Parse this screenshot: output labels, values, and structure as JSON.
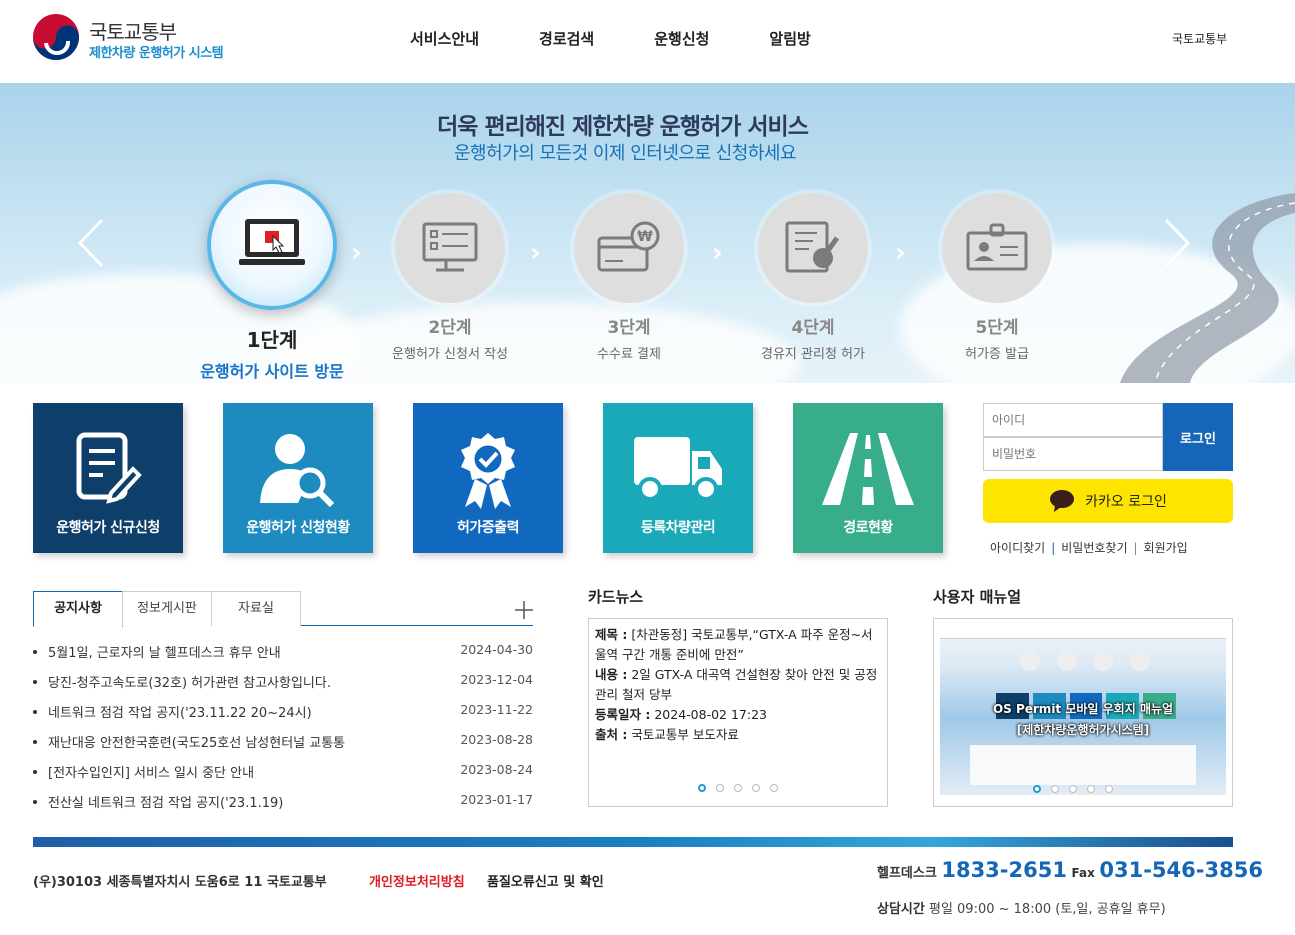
{
  "header": {
    "logo_title": "국토교통부",
    "logo_subtitle": "제한차량 운행허가 시스템",
    "nav": [
      "서비스안내",
      "경로검색",
      "운행신청",
      "알림방"
    ],
    "top_link": "국토교통부"
  },
  "hero": {
    "title": "더욱 편리해진 제한차량 운행허가 서비스",
    "subtitle": "운행허가의 모든것 이제 인터넷으로 신청하세요",
    "steps": [
      {
        "num": "1단계",
        "desc": "운행허가 사이트 방문",
        "icon": "laptop-icon",
        "active": true
      },
      {
        "num": "2단계",
        "desc": "운행허가 신청서 작성",
        "icon": "monitor-form-icon"
      },
      {
        "num": "3단계",
        "desc": "수수료 결제",
        "icon": "card-won-icon"
      },
      {
        "num": "4단계",
        "desc": "경유지 관리청 허가",
        "icon": "approval-stamp-icon"
      },
      {
        "num": "5단계",
        "desc": "허가증 발급",
        "icon": "id-card-icon"
      }
    ]
  },
  "tiles": [
    {
      "label": "운행허가 신규신청",
      "color": "#0e3f6b",
      "icon": "document-edit-icon"
    },
    {
      "label": "운행허가 신청현황",
      "color": "#1d8bbf",
      "icon": "user-search-icon"
    },
    {
      "label": "허가증출력",
      "color": "#1169bf",
      "icon": "certificate-badge-icon"
    },
    {
      "label": "등록차량관리",
      "color": "#1aa9b8",
      "icon": "truck-icon"
    },
    {
      "label": "경로현황",
      "color": "#38ad8b",
      "icon": "road-icon"
    }
  ],
  "login": {
    "id_placeholder": "아이디",
    "pw_placeholder": "비밀번호",
    "login_label": "로그인",
    "kakao_label": "카카오 로그인",
    "links": [
      "아이디찾기",
      "비밀번호찾기",
      "회원가입"
    ]
  },
  "notice": {
    "tabs": [
      "공지사항",
      "정보게시판",
      "자료실"
    ],
    "items": [
      {
        "title": "5월1일, 근로자의 날 헬프데스크 휴무 안내",
        "date": "2024-04-30"
      },
      {
        "title": "당진-청주고속도로(32호) 허가관련 참고사항입니다.",
        "date": "2023-12-04"
      },
      {
        "title": "네트워크 점검 작업 공지('23.11.22 20~24시)",
        "date": "2023-11-22"
      },
      {
        "title": "재난대응 안전한국훈련(국도25호선 남성현터널 교통통",
        "date": "2023-08-28"
      },
      {
        "title": "[전자수입인지] 서비스 일시 중단 안내",
        "date": "2023-08-24"
      },
      {
        "title": "전산실 네트워크 점검 작업 공지('23.1.19)",
        "date": "2023-01-17"
      }
    ]
  },
  "cardnews": {
    "section_title": "카드뉴스",
    "subject_label": "제목 :",
    "subject": "[차관동정] 국토교통부,“GTX-A 파주 운정~서울역 구간 개통 준비에 만전”",
    "content_label": "내용 :",
    "content": "2일 GTX-A 대곡역 건설현장 찾아 안전 및 공정관리 철저 당부",
    "date_label": "등록일자 :",
    "date": "2024-08-02 17:23",
    "source_label": "출처 :",
    "source": "국토교통부 보도자료"
  },
  "manual": {
    "section_title": "사용자 매뉴얼",
    "caption1": "OS Permit 모바일 우회지 매뉴얼",
    "caption2": "[제한차량운행허가시스템]"
  },
  "footer": {
    "address": "(우)30103 세종특별자치시 도움6로 11 국토교통부",
    "privacy": "개인정보처리방침",
    "quality": "품질오류신고 및 확인",
    "help_label": "헬프데스크",
    "help_number": "1833-2651",
    "fax_label": "Fax",
    "fax_number": "031-546-3856",
    "hours_label": "상담시간",
    "hours": "평일 09:00 ~ 18:00 (토,일, 공휴일 휴무)"
  }
}
